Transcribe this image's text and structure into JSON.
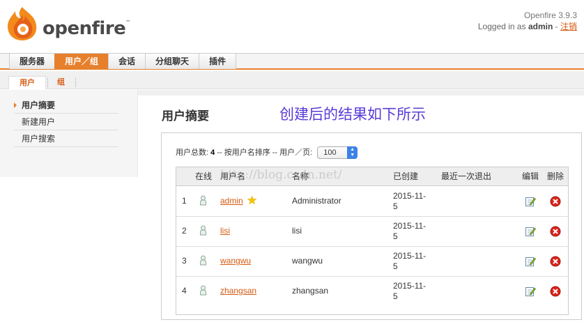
{
  "header": {
    "logo_text": "openfire",
    "logo_tm": "™",
    "version": "Openfire 3.9.3",
    "logged_in_prefix": "Logged in as",
    "user": "admin",
    "separator": "-",
    "logout": "注销"
  },
  "main_tabs": [
    "服务器",
    "用户／组",
    "会话",
    "分组聊天",
    "插件"
  ],
  "sub_tabs": [
    "用户",
    "组"
  ],
  "sidebar": {
    "items": [
      "用户摘要",
      "新建用户",
      "用户搜索"
    ]
  },
  "page": {
    "title": "用户摘要",
    "annotation": "创建后的结果如下所示"
  },
  "summary": {
    "total_label": "用户总数:",
    "total": "4",
    "sort_text": "-- 按用户名排序 -- 用户／页:",
    "per_page": "100"
  },
  "table": {
    "headers": [
      "在线",
      "用户名",
      "名称",
      "已创建",
      "最近一次退出",
      "编辑",
      "删除"
    ],
    "rows": [
      {
        "num": "1",
        "username": "admin",
        "name": "Administrator",
        "created_1": "2015-11-",
        "created_2": "5"
      },
      {
        "num": "2",
        "username": "lisi",
        "name": "lisi",
        "created_1": "2015-11-",
        "created_2": "5"
      },
      {
        "num": "3",
        "username": "wangwu",
        "name": "wangwu",
        "created_1": "2015-11-",
        "created_2": "5"
      },
      {
        "num": "4",
        "username": "zhangsan",
        "name": "zhangsan",
        "created_1": "2015-11-",
        "created_2": "5"
      }
    ]
  },
  "watermark": "http://blog.csdn.net/",
  "icons": {
    "logo": "openfire-flame-icon",
    "online": "user-offline-icon",
    "admin_badge": "star-icon",
    "edit": "edit-icon",
    "delete": "delete-icon"
  },
  "colors": {
    "accent": "#e6802d",
    "link": "#d65a12",
    "annotation": "#5a3bd6",
    "delete": "#d9251c"
  }
}
